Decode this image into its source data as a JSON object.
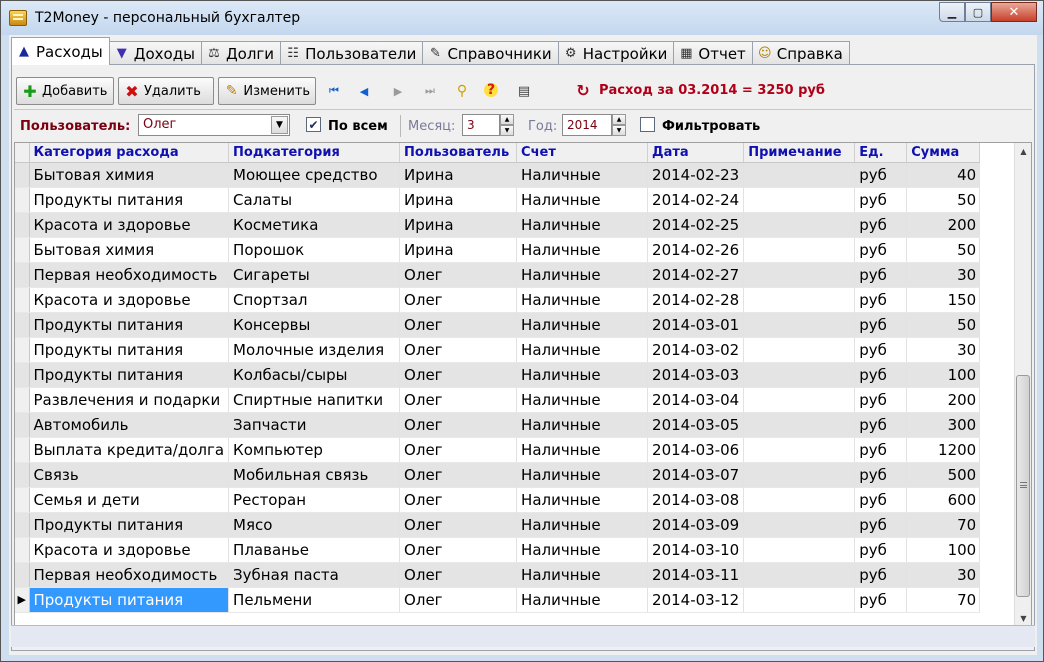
{
  "window": {
    "title": "T2Money - персональный бухгалтер",
    "min_glyph": "▁",
    "max_glyph": "▢",
    "close_glyph": "✕"
  },
  "tabs": [
    {
      "label": "Расходы",
      "icon": "expense-arrow-icon",
      "glyph": "▲",
      "color": "#1a2a9a"
    },
    {
      "label": "Доходы",
      "icon": "income-arrow-icon",
      "glyph": "▼",
      "color": "#4030b0"
    },
    {
      "label": "Долги",
      "icon": "debts-icon",
      "glyph": "⚖",
      "color": "#303030"
    },
    {
      "label": "Пользователи",
      "icon": "users-icon",
      "glyph": "☷",
      "color": "#303030"
    },
    {
      "label": "Справочники",
      "icon": "references-icon",
      "glyph": "✎",
      "color": "#303030"
    },
    {
      "label": "Настройки",
      "icon": "settings-icon",
      "glyph": "⚙",
      "color": "#303030"
    },
    {
      "label": "Отчет",
      "icon": "report-icon",
      "glyph": "▦",
      "color": "#303030"
    },
    {
      "label": "Справка",
      "icon": "help-icon",
      "glyph": "☺",
      "color": "#b08000"
    }
  ],
  "toolbar": {
    "add_label": "Добавить",
    "delete_label": "Удалить",
    "edit_label": "Изменить",
    "summary": "Расход за 03.2014 = 3250 руб"
  },
  "filter": {
    "user_label": "Пользователь:",
    "user_value": "Олег",
    "all_label": "По всем",
    "month_label": "Месяц:",
    "month_value": "3",
    "year_label": "Год:",
    "year_value": "2014",
    "filter_label": "Фильтровать"
  },
  "grid": {
    "columns": [
      "Категория расхода",
      "Подкатегория",
      "Пользователь",
      "Счет",
      "Дата",
      "Примечание",
      "Ед.",
      "Сумма"
    ],
    "rows": [
      [
        "Бытовая химия",
        "Моющее средство",
        "Ирина",
        "Наличные",
        "2014-02-23",
        "",
        "руб",
        "40"
      ],
      [
        "Продукты питания",
        "Салаты",
        "Ирина",
        "Наличные",
        "2014-02-24",
        "",
        "руб",
        "50"
      ],
      [
        "Красота и здоровье",
        "Косметика",
        "Ирина",
        "Наличные",
        "2014-02-25",
        "",
        "руб",
        "200"
      ],
      [
        "Бытовая химия",
        "Порошок",
        "Ирина",
        "Наличные",
        "2014-02-26",
        "",
        "руб",
        "50"
      ],
      [
        "Первая необходимость",
        "Сигареты",
        "Олег",
        "Наличные",
        "2014-02-27",
        "",
        "руб",
        "30"
      ],
      [
        "Красота и здоровье",
        "Спортзал",
        "Олег",
        "Наличные",
        "2014-02-28",
        "",
        "руб",
        "150"
      ],
      [
        "Продукты питания",
        "Консервы",
        "Олег",
        "Наличные",
        "2014-03-01",
        "",
        "руб",
        "50"
      ],
      [
        "Продукты питания",
        "Молочные изделия",
        "Олег",
        "Наличные",
        "2014-03-02",
        "",
        "руб",
        "30"
      ],
      [
        "Продукты питания",
        "Колбасы/сыры",
        "Олег",
        "Наличные",
        "2014-03-03",
        "",
        "руб",
        "100"
      ],
      [
        "Развлечения и подарки",
        "Спиртные напитки",
        "Олег",
        "Наличные",
        "2014-03-04",
        "",
        "руб",
        "200"
      ],
      [
        "Автомобиль",
        "Запчасти",
        "Олег",
        "Наличные",
        "2014-03-05",
        "",
        "руб",
        "300"
      ],
      [
        "Выплата кредита/долга",
        "Компьютер",
        "Олег",
        "Наличные",
        "2014-03-06",
        "",
        "руб",
        "1200"
      ],
      [
        "Связь",
        "Мобильная связь",
        "Олег",
        "Наличные",
        "2014-03-07",
        "",
        "руб",
        "500"
      ],
      [
        "Семья и дети",
        "Ресторан",
        "Олег",
        "Наличные",
        "2014-03-08",
        "",
        "руб",
        "600"
      ],
      [
        "Продукты питания",
        "Мясо",
        "Олег",
        "Наличные",
        "2014-03-09",
        "",
        "руб",
        "70"
      ],
      [
        "Красота и здоровье",
        "Плаванье",
        "Олег",
        "Наличные",
        "2014-03-10",
        "",
        "руб",
        "100"
      ],
      [
        "Первая необходимость",
        "Зубная паста",
        "Олег",
        "Наличные",
        "2014-03-11",
        "",
        "руб",
        "30"
      ],
      [
        "Продукты питания",
        "Пельмени",
        "Олег",
        "Наличные",
        "2014-03-12",
        "",
        "руб",
        "70"
      ]
    ],
    "selected_row": 17,
    "current_row_marker": "▶"
  },
  "colors": {
    "summary": "#b00018",
    "header_text": "#1010b0",
    "selection": "#3399ff"
  }
}
